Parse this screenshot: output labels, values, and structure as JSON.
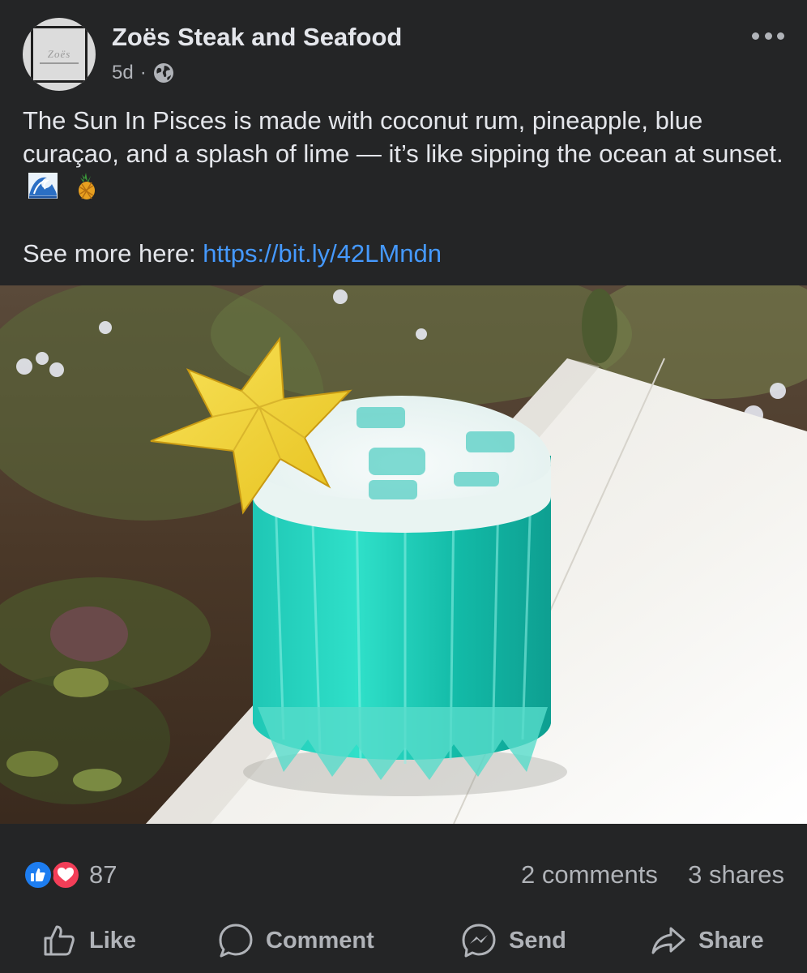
{
  "post": {
    "page_name": "Zoës Steak and Seafood",
    "avatar_logo_text": "Zoës",
    "time_ago": "5d",
    "separator": "·",
    "audience_icon": "globe-icon",
    "more_icon": "more-options-icon",
    "caption_text": "The Sun In Pisces is made with coconut rum, pineapple, blue curaçao, and a splash of lime — it’s like sipping the ocean at sunset.",
    "caption_emojis": [
      "wave-emoji",
      "pineapple-emoji"
    ],
    "see_more_label": "See more here:",
    "link": "https://bit.ly/42LMndn",
    "photo_alt": "blue-cocktail-photo"
  },
  "stats": {
    "reaction_icons": [
      "like-reaction-icon",
      "love-reaction-icon"
    ],
    "reaction_count": "87",
    "comments": "2 comments",
    "shares": "3 shares"
  },
  "actions": {
    "like": "Like",
    "comment": "Comment",
    "send": "Send",
    "share": "Share"
  },
  "colors": {
    "background": "#242526",
    "text": "#e4e6eb",
    "secondary_text": "#b0b3b8",
    "link": "#4599ff",
    "like_blue": "#1d7df0",
    "love_red": "#f33e58"
  }
}
